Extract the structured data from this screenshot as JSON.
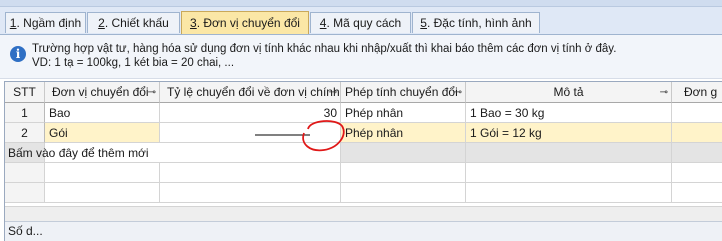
{
  "tabs": [
    {
      "num": "1",
      "label": ". Ngầm định"
    },
    {
      "num": "2",
      "label": ". Chiết khấu"
    },
    {
      "num": "3",
      "label": ". Đơn vị chuyển đổi"
    },
    {
      "num": "4",
      "label": ". Mã quy cách"
    },
    {
      "num": "5",
      "label": ". Đặc tính, hình ảnh"
    }
  ],
  "info": {
    "line1": "Trường hợp vật tư, hàng hóa sử dụng đơn vị tính khác nhau khi nhập/xuất thì khai báo thêm các đơn vị tính ở đây.",
    "line2": "VD: 1 tạ = 100kg, 1 két bia = 20 chai, ..."
  },
  "grid": {
    "headers": {
      "stt": "STT",
      "unit": "Đơn vị chuyển đổi",
      "ratio": "Tỷ lệ chuyển đổi về đơn vị chính",
      "op": "Phép tính chuyển đổi",
      "desc": "Mô tả",
      "price": "Đơn g"
    },
    "rows": [
      {
        "stt": "1",
        "unit": "Bao",
        "ratio": "30",
        "op": "Phép nhân",
        "desc": "1 Bao = 30 kg"
      },
      {
        "stt": "2",
        "unit": "Gói",
        "ratio": "",
        "op": "Phép nhân",
        "desc": "1 Gói = 12 kg"
      }
    ],
    "new_row_hint": "Bấm vào đây để thêm mới",
    "footer": "Số d..."
  }
}
